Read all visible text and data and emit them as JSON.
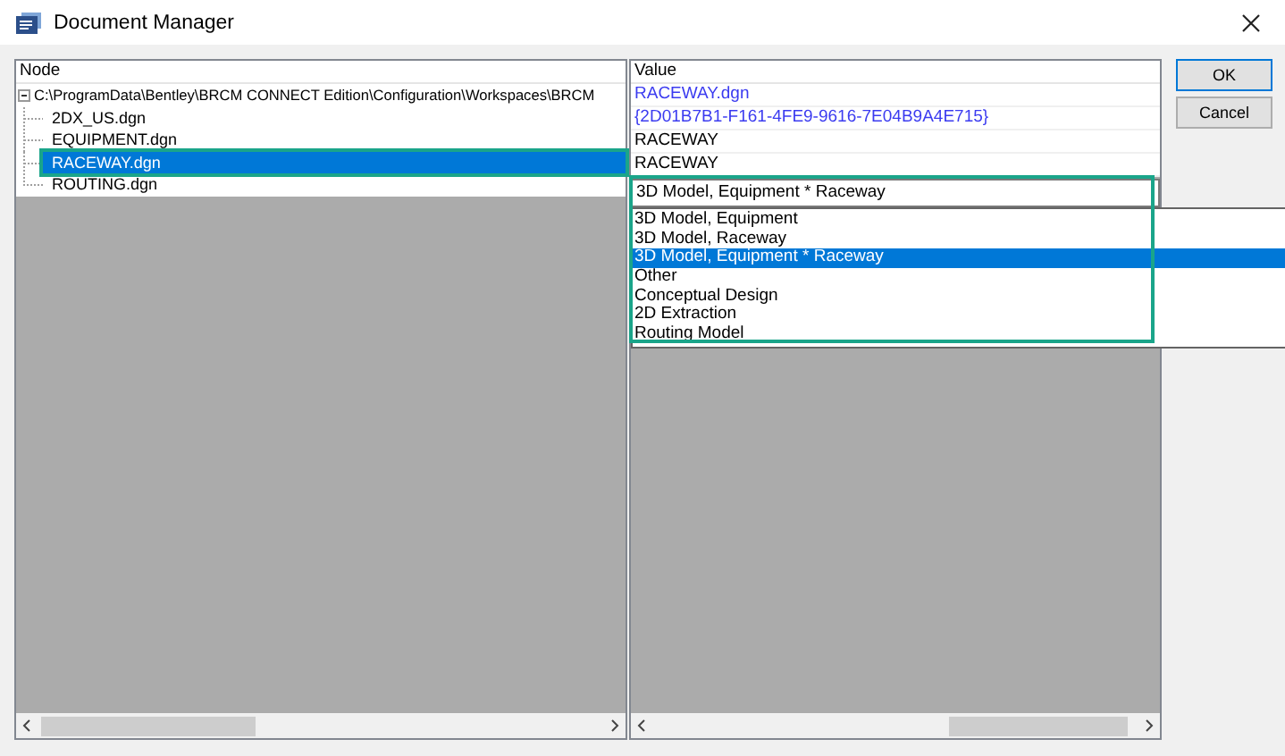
{
  "window": {
    "title": "Document Manager"
  },
  "tree": {
    "header": "Node",
    "root": {
      "label": "C:\\ProgramData\\Bentley\\BRCM CONNECT Edition\\Configuration\\Workspaces\\BRCM",
      "expanded": true,
      "children": [
        {
          "label": "2DX_US.dgn",
          "selected": false,
          "highlighted": false
        },
        {
          "label": "EQUIPMENT.dgn",
          "selected": false,
          "highlighted": false
        },
        {
          "label": "RACEWAY.dgn",
          "selected": true,
          "highlighted": true
        },
        {
          "label": "ROUTING.dgn",
          "selected": false,
          "highlighted": false
        }
      ]
    }
  },
  "values": {
    "header": "Value",
    "rows": [
      {
        "text": "RACEWAY.dgn",
        "kind": "link"
      },
      {
        "text": "{2D01B7B1-F161-4FE9-9616-7E04B9A4E715}",
        "kind": "link"
      },
      {
        "text": "RACEWAY",
        "kind": "plain"
      },
      {
        "text": "RACEWAY",
        "kind": "plain"
      }
    ]
  },
  "combo": {
    "value": "3D Model, Equipment * Raceway",
    "highlighted": true,
    "options": [
      {
        "label": "3D Model, Equipment",
        "selected": false
      },
      {
        "label": "3D Model, Raceway",
        "selected": false
      },
      {
        "label": "3D Model, Equipment * Raceway",
        "selected": true
      },
      {
        "label": "Other",
        "selected": false
      },
      {
        "label": "Conceptual Design",
        "selected": false
      },
      {
        "label": "2D Extraction",
        "selected": false
      },
      {
        "label": "Routing Model",
        "selected": false
      }
    ]
  },
  "buttons": [
    {
      "label": "OK",
      "default": true
    },
    {
      "label": "Cancel",
      "default": false
    }
  ]
}
